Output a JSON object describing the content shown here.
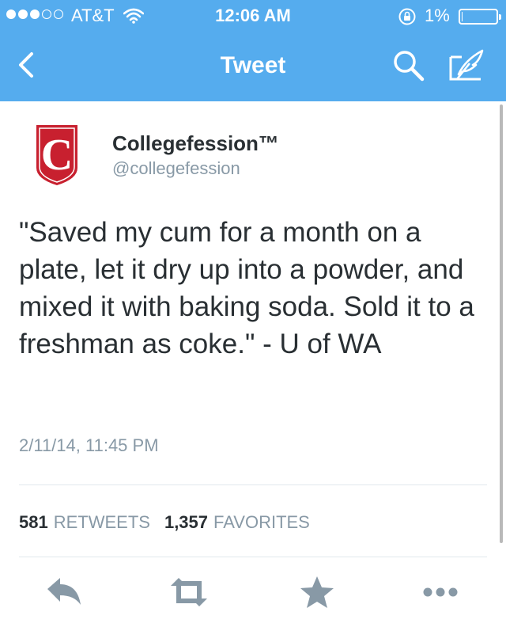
{
  "status_bar": {
    "signal_bars_filled": 3,
    "signal_bars_total": 5,
    "carrier": "AT&T",
    "time": "12:06 AM",
    "battery_percent": "1%",
    "battery_level": 0.01
  },
  "nav": {
    "title": "Tweet",
    "icons": {
      "back": "chevron-left-icon",
      "search": "search-icon",
      "compose": "compose-icon"
    }
  },
  "tweet": {
    "avatar_letter": "C",
    "author_name": "Collegefession™",
    "author_handle": "@collegefession",
    "text": "\"Saved my cum for a month on a plate, let it dry up into a powder, and mixed it with baking soda. Sold it to a freshman as coke.\" - U of WA",
    "timestamp": "2/11/14, 11:45 PM",
    "retweets_count": "581",
    "retweets_label": "RETWEETS",
    "favorites_count": "1,357",
    "favorites_label": "FAVORITES"
  },
  "actions": [
    "reply-icon",
    "retweet-icon",
    "favorite-icon",
    "more-icon"
  ],
  "colors": {
    "brand": "#55acee",
    "text": "#292f33",
    "secondary": "#8899a6",
    "action_icon": "#8899a6",
    "avatar_red": "#c8202f"
  }
}
